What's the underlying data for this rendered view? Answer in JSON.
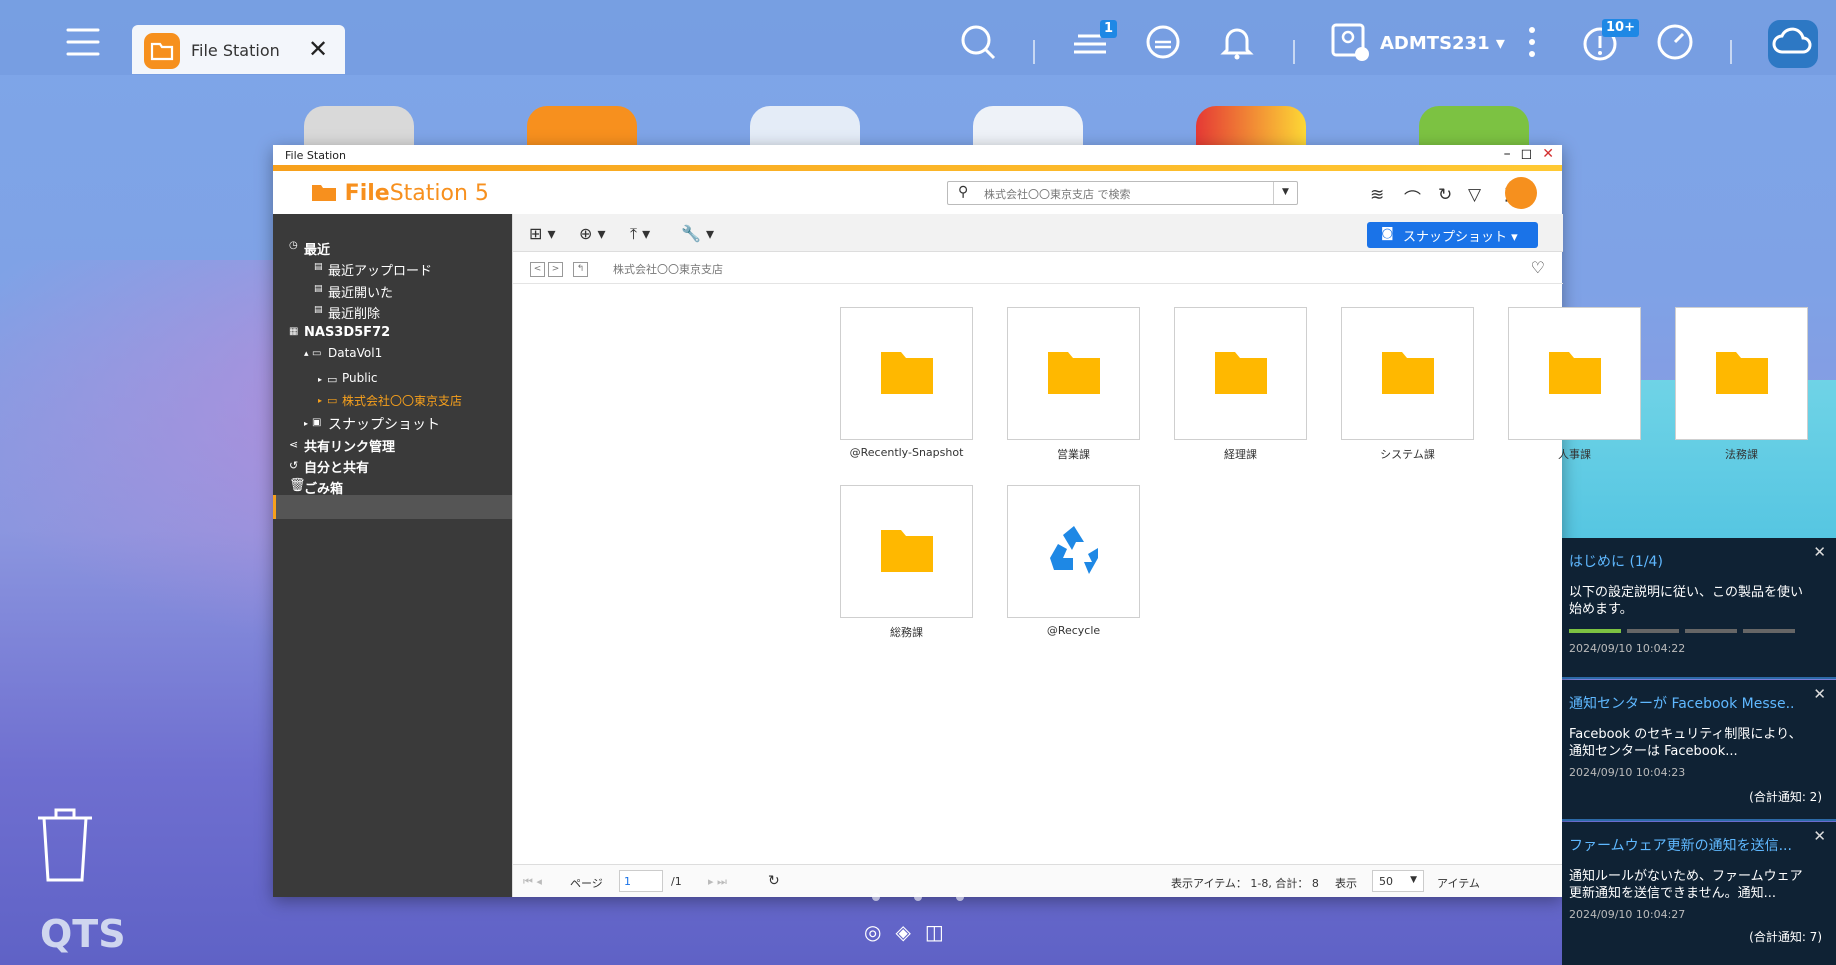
{
  "taskbar": {
    "tab_label": "File Station",
    "close_glyph": "✕",
    "tasks_badge": "1",
    "username": "ADMTS231",
    "user_caret": "▾",
    "notif_badge": "10+"
  },
  "window": {
    "title": "File Station",
    "minimize": "–",
    "maximize": "◻",
    "close": "✕"
  },
  "header": {
    "logo_bold": "File",
    "logo_rest": "Station 5",
    "search_placeholder": "株式会社〇〇東京支店 で検索"
  },
  "sidebar": {
    "recent": "最近",
    "recent_upload": "最近アップロード",
    "recent_opened": "最近開いた",
    "recent_deleted": "最近削除",
    "nas": "NAS3D5F72",
    "volume": "DataVol1",
    "public": "Public",
    "selected_folder": "株式会社〇〇東京支店",
    "snapshot": "スナップショット",
    "share_links": "共有リンク管理",
    "shared_with_me": "自分と共有",
    "trash": "ごみ箱"
  },
  "toolbar": {
    "snapshot_button": "スナップショット ▾"
  },
  "pathbar": {
    "path": "株式会社〇〇東京支店"
  },
  "folders": [
    {
      "label": "@Recently-Snapshot"
    },
    {
      "label": "営業課"
    },
    {
      "label": "経理課"
    },
    {
      "label": "システム課"
    },
    {
      "label": "人事課"
    },
    {
      "label": "法務課"
    },
    {
      "label": "総務課"
    },
    {
      "label": "@Recycle"
    }
  ],
  "status": {
    "page_label": "ページ",
    "page_value": "1",
    "page_total": "/1",
    "items_info": "表示アイテム： 1-8, 合計： 8",
    "show_label": "表示",
    "per_page": "50",
    "items_label": "アイテム"
  },
  "notifications": [
    {
      "title": "はじめに (1/4)",
      "body": "以下の設定説明に従い、この製品を使い始めます。",
      "time": "2024/09/10 10:04:22"
    },
    {
      "title": "通知センターが Facebook Messe...",
      "body": "Facebook のセキュリティ制限により、通知センターは Facebook...",
      "time": "2024/09/10 10:04:23",
      "count": "(合計通知: 2)"
    },
    {
      "title": "ファームウェア更新の通知を送信...",
      "body": "通知ルールがないため、ファームウェア更新通知を送信できません。通知...",
      "time": "2024/09/10 10:04:27",
      "count": "(合計通知: 7)"
    }
  ],
  "desktop": {
    "brand": "QTS"
  }
}
